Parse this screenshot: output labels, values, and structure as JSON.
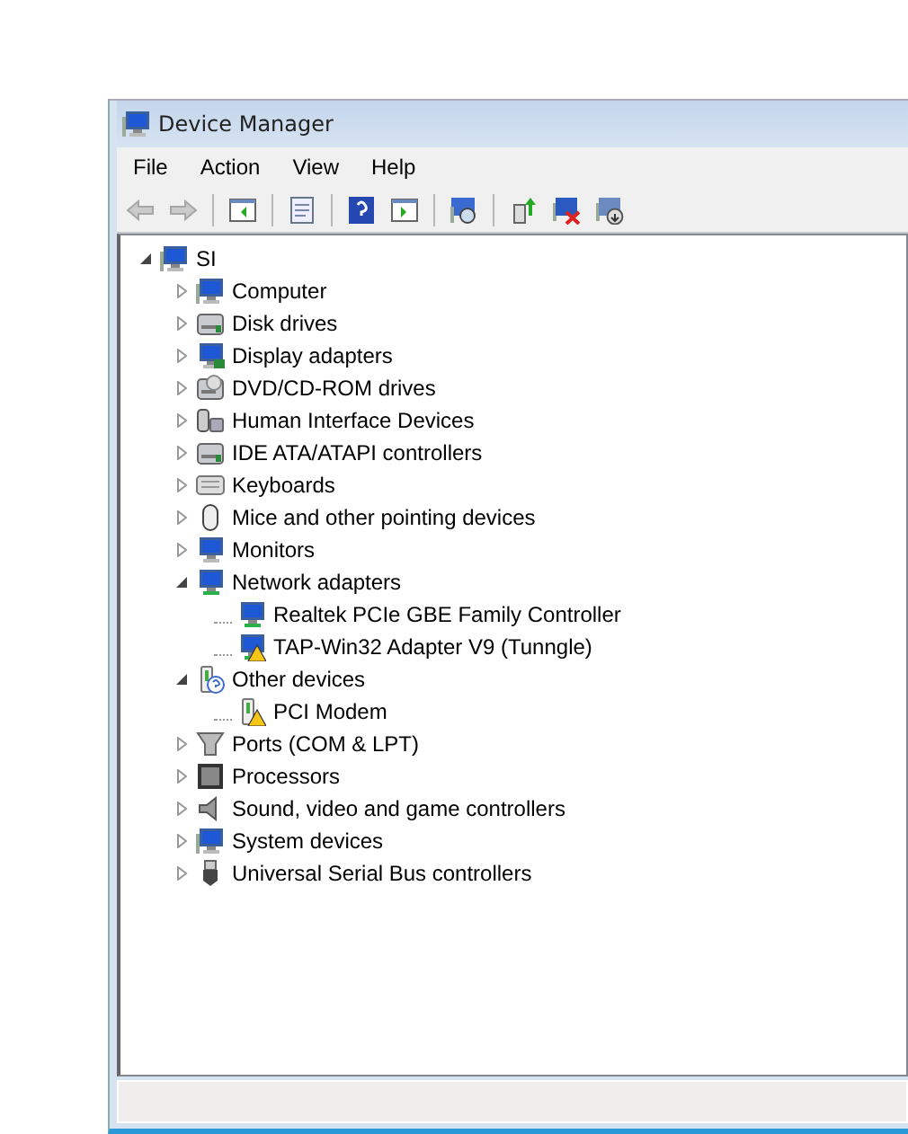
{
  "window": {
    "title": "Device Manager"
  },
  "menu": [
    "File",
    "Action",
    "View",
    "Help"
  ],
  "toolbar": [
    {
      "kind": "back",
      "disabled": true
    },
    {
      "kind": "forward",
      "disabled": true
    },
    {
      "kind": "sep"
    },
    {
      "kind": "console"
    },
    {
      "kind": "sep"
    },
    {
      "kind": "properties"
    },
    {
      "kind": "sep"
    },
    {
      "kind": "help"
    },
    {
      "kind": "pane"
    },
    {
      "kind": "sep"
    },
    {
      "kind": "scan"
    },
    {
      "kind": "sep"
    },
    {
      "kind": "update"
    },
    {
      "kind": "uninstall"
    },
    {
      "kind": "disable"
    }
  ],
  "tree": {
    "label": "SI",
    "kind": "computer",
    "expanded": true,
    "children": [
      {
        "label": "Computer",
        "kind": "computer",
        "expanded": false
      },
      {
        "label": "Disk drives",
        "kind": "disk",
        "expanded": false
      },
      {
        "label": "Display adapters",
        "kind": "display",
        "expanded": false
      },
      {
        "label": "DVD/CD-ROM drives",
        "kind": "optical",
        "expanded": false
      },
      {
        "label": "Human Interface Devices",
        "kind": "hid",
        "expanded": false
      },
      {
        "label": "IDE ATA/ATAPI controllers",
        "kind": "disk",
        "expanded": false
      },
      {
        "label": "Keyboards",
        "kind": "keyboard",
        "expanded": false
      },
      {
        "label": "Mice and other pointing devices",
        "kind": "mouse",
        "expanded": false
      },
      {
        "label": "Monitors",
        "kind": "monitor",
        "expanded": false
      },
      {
        "label": "Network adapters",
        "kind": "network",
        "expanded": true,
        "children": [
          {
            "label": "Realtek PCIe GBE Family Controller",
            "kind": "network",
            "warning": false
          },
          {
            "label": "TAP-Win32 Adapter V9 (Tunngle)",
            "kind": "network",
            "warning": true
          }
        ]
      },
      {
        "label": "Other devices",
        "kind": "unknown",
        "expanded": true,
        "children": [
          {
            "label": "PCI Modem",
            "kind": "device",
            "warning": true
          }
        ]
      },
      {
        "label": "Ports (COM & LPT)",
        "kind": "port",
        "expanded": false
      },
      {
        "label": "Processors",
        "kind": "processor",
        "expanded": false
      },
      {
        "label": "Sound, video and game controllers",
        "kind": "sound",
        "expanded": false
      },
      {
        "label": "System devices",
        "kind": "computer",
        "expanded": false
      },
      {
        "label": "Universal Serial Bus controllers",
        "kind": "usb",
        "expanded": false
      }
    ]
  }
}
